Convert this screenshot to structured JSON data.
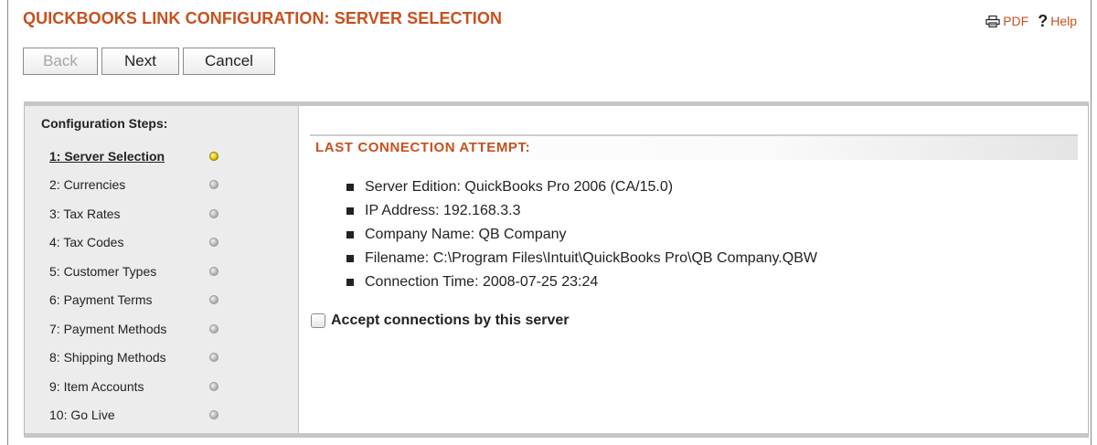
{
  "header": {
    "title": "QUICKBOOKS LINK CONFIGURATION: SERVER SELECTION",
    "pdf_label": "PDF",
    "help_label": "Help"
  },
  "toolbar": {
    "back_label": "Back",
    "next_label": "Next",
    "cancel_label": "Cancel"
  },
  "sidebar": {
    "heading": "Configuration Steps:",
    "steps": [
      {
        "label": "1: Server Selection",
        "active": true
      },
      {
        "label": "2: Currencies"
      },
      {
        "label": "3: Tax Rates"
      },
      {
        "label": "4: Tax Codes"
      },
      {
        "label": "5: Customer Types"
      },
      {
        "label": "6: Payment Terms"
      },
      {
        "label": "7: Payment Methods"
      },
      {
        "label": "8: Shipping Methods"
      },
      {
        "label": "9: Item Accounts"
      },
      {
        "label": "10: Go Live"
      }
    ]
  },
  "main": {
    "heading": "LAST CONNECTION ATTEMPT:",
    "details": [
      "Server Edition: QuickBooks Pro 2006 (CA/15.0)",
      "IP Address: 192.168.3.3",
      "Company Name: QB Company",
      "Filename: C:\\Program Files\\Intuit\\QuickBooks Pro\\QB Company.QBW",
      "Connection Time: 2008-07-25 23:24"
    ],
    "accept_label": "Accept connections by this server",
    "accept_checked": false
  },
  "colors": {
    "accent": "#c8501e",
    "sidebar_bg": "#ececec",
    "active_dot": "#e2c800"
  }
}
